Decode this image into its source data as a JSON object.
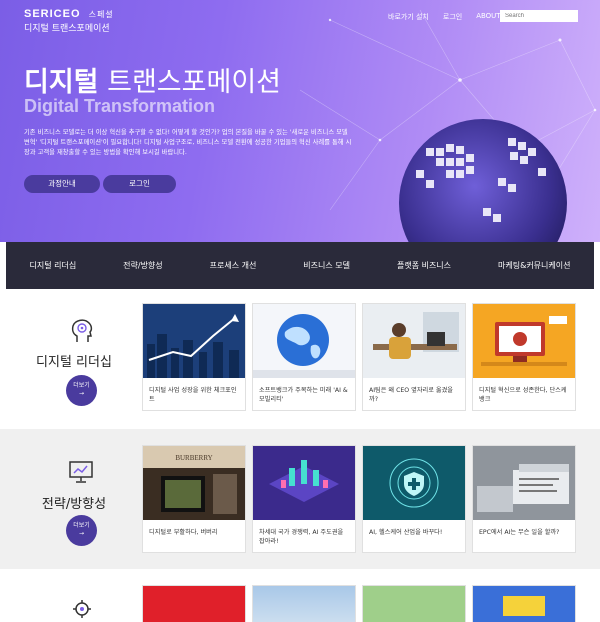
{
  "header": {
    "logo_brand": "SERICEO",
    "logo_tag": "스페셜",
    "logo_sub": "디지털 트랜스포메이션",
    "nav": [
      "바로가기 설치",
      "로그인",
      "ABOUT"
    ],
    "search_placeholder": "Search"
  },
  "hero": {
    "title_bold": "디지털",
    "title_rest": " 트랜스포메이션",
    "subtitle": "Digital Transformation",
    "description": "기존 비즈니스 모델로는 더 이상 혁신을 추구할 수 없다! 어떻게 할 것인가? 업의 본질을 바꿀 수 있는 '새로운 비즈니스 모델 변혁' '디지털 트랜스포메이션'이 필요합니다! 디지털 사업구조로, 비즈니스 모델 전환에 성공한 기업들의 혁신 사례를 통해 시장과 고객을 재창출할 수 있는 방법을 확인해 보시길 바랍니다.",
    "btn_course": "과정안내",
    "btn_login": "로그인"
  },
  "categories": [
    "디지털 리더십",
    "전략/방향성",
    "프로세스 개선",
    "비즈니스 모델",
    "플랫폼 비즈니스",
    "마케팅&커뮤니케이션"
  ],
  "sections": [
    {
      "title": "디지털 리더십",
      "icon": "head-gear-icon",
      "more": "더보기",
      "arrow": "→",
      "cards": [
        {
          "caption": "디지털 사업 성장을 위한 체크포인트"
        },
        {
          "caption": "소프트뱅크가 주목하는 미래 'AI & 모빌리티'"
        },
        {
          "caption": "AI팀은 왜 CEO 옆자리로 옮겼을까?"
        },
        {
          "caption": "디지털 혁신으로 성존한다, 단스케 뱅크"
        }
      ]
    },
    {
      "title": "전략/방향성",
      "icon": "monitor-chart-icon",
      "more": "더보기",
      "arrow": "→",
      "cards": [
        {
          "caption": "디지털로 부활하다, 버버리",
          "sign": "BURBERRY"
        },
        {
          "caption": "차세대 국가 경쟁력, AI 주도권을 잡아라!"
        },
        {
          "caption": "AI, 헬스케어 산업을 바꾸다!"
        },
        {
          "caption": "EPC에서 AI는 무슨 일을 할까?"
        }
      ]
    },
    {
      "title": "",
      "icon": "process-gear-icon"
    }
  ],
  "colors": {
    "accent": "#4a3b9e",
    "bar": "#2a2a3a",
    "hero": "#8e6cf0"
  }
}
